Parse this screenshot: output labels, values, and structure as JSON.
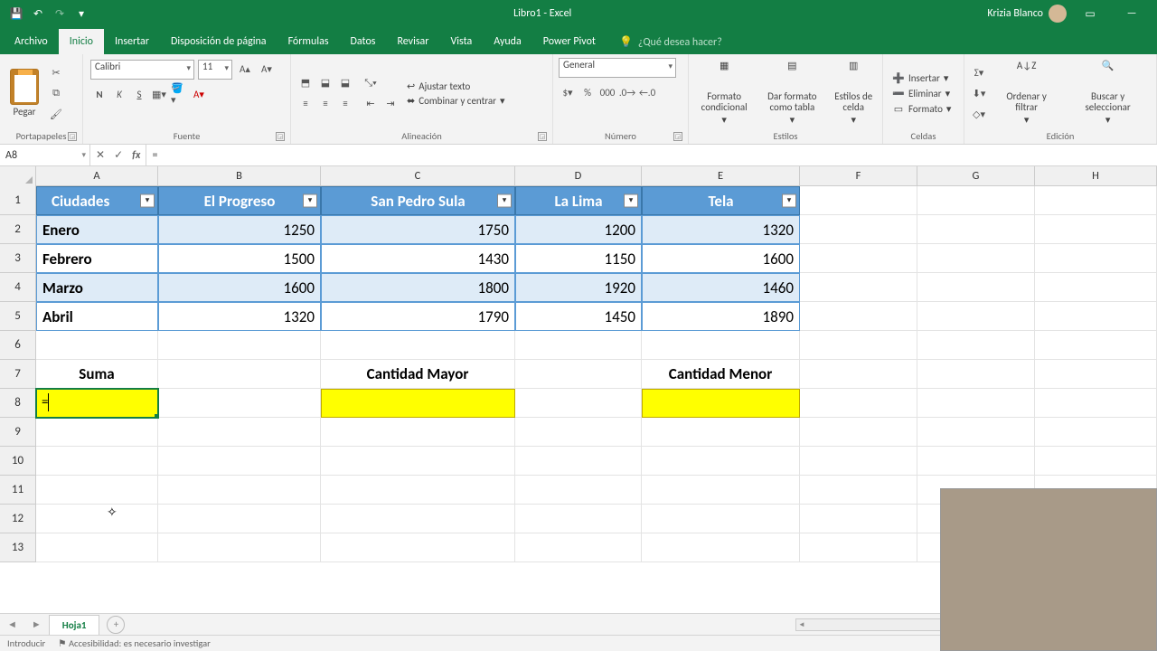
{
  "app": {
    "title": "Libro1  -  Excel",
    "user": "Krizia Blanco"
  },
  "tabs": [
    "Archivo",
    "Inicio",
    "Insertar",
    "Disposición de página",
    "Fórmulas",
    "Datos",
    "Revisar",
    "Vista",
    "Ayuda",
    "Power Pivot"
  ],
  "tellme": "¿Qué desea hacer?",
  "ribbon": {
    "paste": "Pegar",
    "clipboard": "Portapapeles",
    "font_name": "Calibri",
    "font_size": "11",
    "font_group": "Fuente",
    "wrap": "Ajustar texto",
    "merge": "Combinar y centrar",
    "align_group": "Alineación",
    "number_format": "General",
    "number_group": "Número",
    "cond": "Formato condicional",
    "table": "Dar formato como tabla",
    "cellstyles": "Estilos de celda",
    "styles_group": "Estilos",
    "insert": "Insertar",
    "delete": "Eliminar",
    "format": "Formato",
    "cells_group": "Celdas",
    "sort": "Ordenar y filtrar",
    "find": "Buscar y seleccionar",
    "edit_group": "Edición"
  },
  "namebox": "A8",
  "formula": "=",
  "columns": [
    "A",
    "B",
    "C",
    "D",
    "E",
    "F",
    "G",
    "H"
  ],
  "rows": [
    "1",
    "2",
    "3",
    "4",
    "5",
    "6",
    "7",
    "8",
    "9",
    "10",
    "11",
    "12",
    "13"
  ],
  "table": {
    "headers": [
      "Ciudades",
      "El Progreso",
      "San Pedro Sula",
      "La Lima",
      "Tela"
    ],
    "rows": [
      {
        "label": "Enero",
        "v": [
          "1250",
          "1750",
          "1200",
          "1320"
        ]
      },
      {
        "label": "Febrero",
        "v": [
          "1500",
          "1430",
          "1150",
          "1600"
        ]
      },
      {
        "label": "Marzo",
        "v": [
          "1600",
          "1800",
          "1920",
          "1460"
        ]
      },
      {
        "label": "Abril",
        "v": [
          "1320",
          "1790",
          "1450",
          "1890"
        ]
      }
    ]
  },
  "labels": {
    "suma": "Suma",
    "mayor": "Cantidad Mayor",
    "menor": "Cantidad Menor"
  },
  "active_cell_text": "=",
  "sheet_tab": "Hoja1",
  "status_mode": "Introducir",
  "status_acc": "Accesibilidad: es necesario investigar"
}
